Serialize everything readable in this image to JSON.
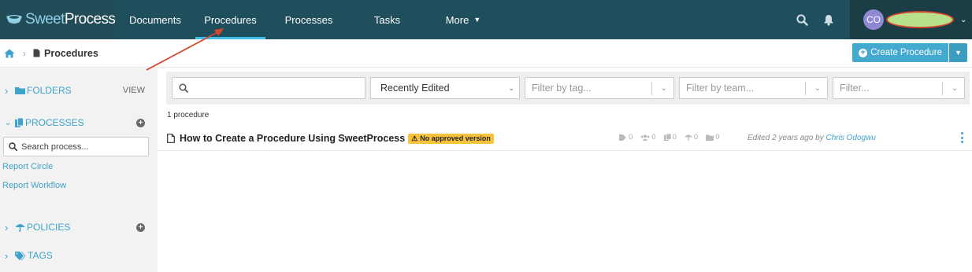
{
  "app": {
    "logo_text_light": "Sweet",
    "logo_text_bold": "Process"
  },
  "nav": {
    "items": [
      {
        "label": "Documents"
      },
      {
        "label": "Procedures"
      },
      {
        "label": "Processes"
      },
      {
        "label": "Tasks"
      },
      {
        "label": "More"
      }
    ],
    "active": "Procedures"
  },
  "user": {
    "initials": "CO"
  },
  "breadcrumb": {
    "title": "Procedures"
  },
  "create_button": {
    "label": "Create Procedure"
  },
  "sidebar": {
    "folders": {
      "label": "FOLDERS",
      "action": "VIEW"
    },
    "processes": {
      "label": "PROCESSES"
    },
    "search_placeholder": "Search process...",
    "links": [
      {
        "label": "Report Circle"
      },
      {
        "label": "Report Workflow"
      }
    ],
    "policies": {
      "label": "POLICIES"
    },
    "tags": {
      "label": "TAGS"
    }
  },
  "filters": {
    "search_value": "",
    "sort_selected": "Recently Edited",
    "tag_placeholder": "Filter by tag...",
    "team_placeholder": "Filter by team...",
    "other_placeholder": "Filter..."
  },
  "list": {
    "count_text": "1 procedure",
    "items": [
      {
        "title": "How to Create a Procedure Using SweetProcess",
        "badge": "No approved version",
        "stats": {
          "tags": "0",
          "teams": "0",
          "documents": "0",
          "policies": "0",
          "folders": "0"
        },
        "edited_prefix": "Edited 2 years ago by ",
        "author": "Chris Odogwu"
      }
    ]
  },
  "colors": {
    "topbar": "#1f4f5c",
    "accent": "#3ea3cb",
    "active_underline": "#3fc1e8",
    "badge": "#f7c33d",
    "annotation": "#d8452f"
  }
}
